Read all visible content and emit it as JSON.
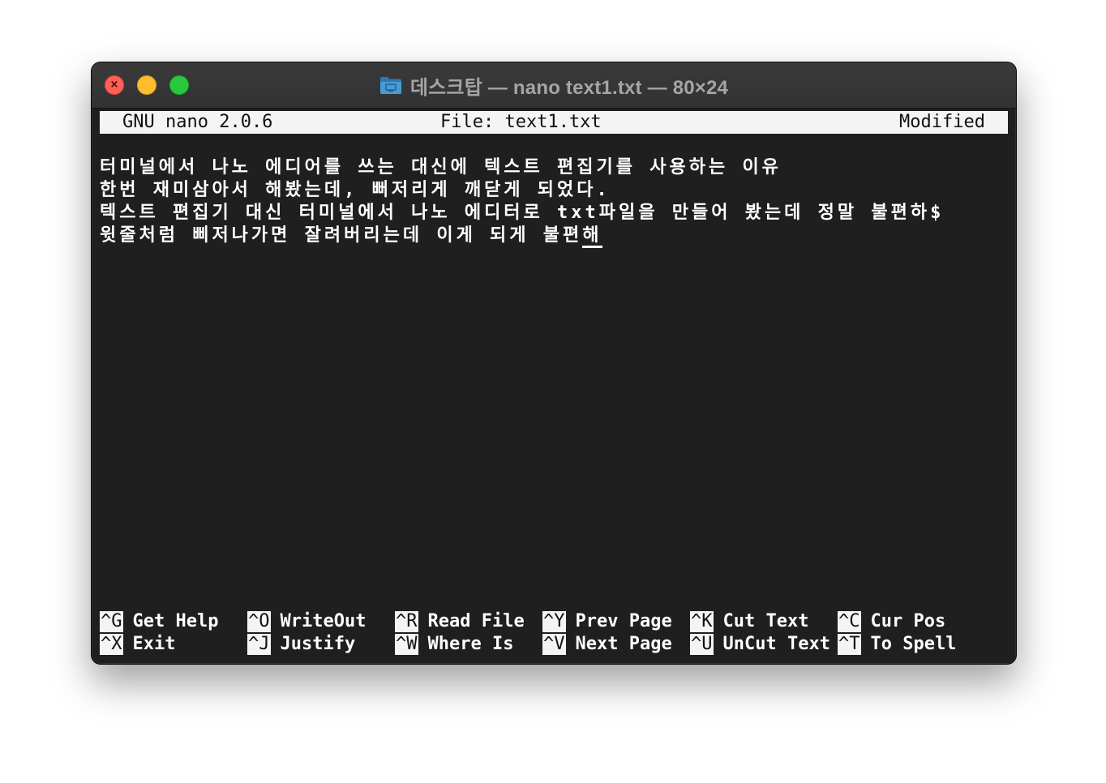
{
  "window": {
    "title": "데스크탑 — nano text1.txt — 80×24",
    "folder_icon": "folder-icon",
    "colors": {
      "close": "#fe5f57",
      "minimize": "#febc2e",
      "zoom": "#28c840",
      "terminal_bg": "#1f1f1f",
      "terminal_fg": "#ffffff"
    }
  },
  "nano": {
    "version": "GNU nano 2.0.6",
    "file": "File: text1.txt",
    "state": "Modified",
    "lines": [
      "터미널에서 나노 에디어를 쓰는 대신에 텍스트 편집기를 사용하는 이유",
      "한번 재미삼아서 해봤는데, 뻐저리게 깨닫게 되었다.",
      "텍스트 편집기 대신 터미널에서 나노 에디터로 txt파일을 만들어 봤는데 정말 불편하$",
      "윗줄처럼 삐저나가면 잘려버리는데 이게 되게 불편"
    ],
    "cursor_char": "해",
    "shortcuts": [
      {
        "key": "^G",
        "label": "Get Help"
      },
      {
        "key": "^O",
        "label": "WriteOut"
      },
      {
        "key": "^R",
        "label": "Read File"
      },
      {
        "key": "^Y",
        "label": "Prev Page"
      },
      {
        "key": "^K",
        "label": "Cut Text"
      },
      {
        "key": "^C",
        "label": "Cur Pos"
      },
      {
        "key": "^X",
        "label": "Exit"
      },
      {
        "key": "^J",
        "label": "Justify"
      },
      {
        "key": "^W",
        "label": "Where Is"
      },
      {
        "key": "^V",
        "label": "Next Page"
      },
      {
        "key": "^U",
        "label": "UnCut Text"
      },
      {
        "key": "^T",
        "label": "To Spell"
      }
    ]
  }
}
